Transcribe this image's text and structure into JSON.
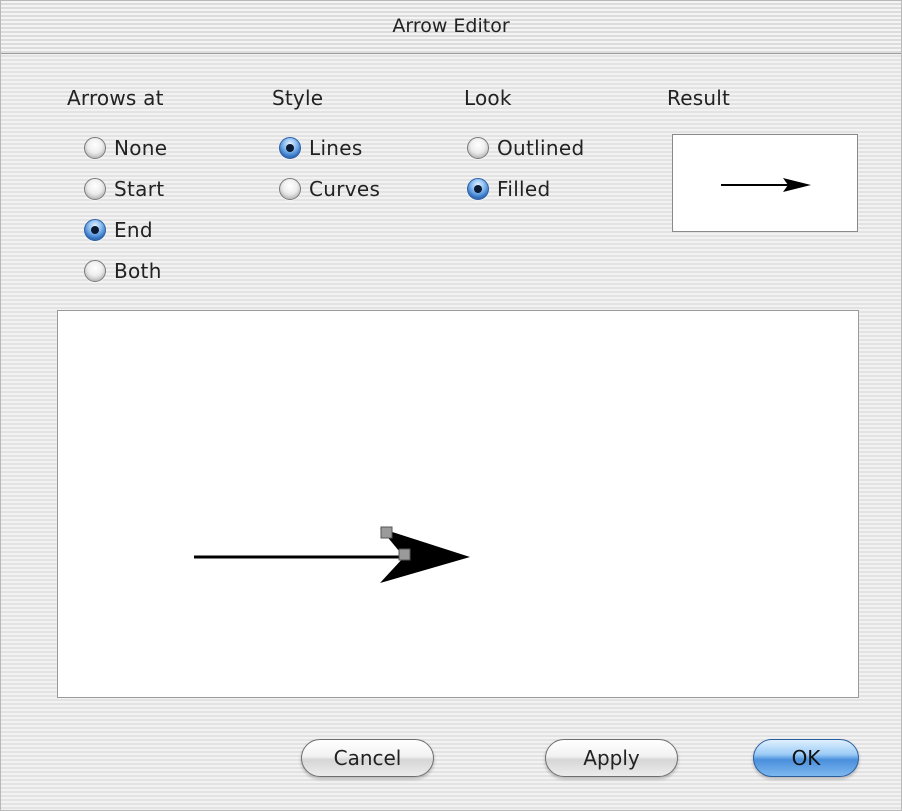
{
  "window": {
    "title": "Arrow Editor"
  },
  "columns": {
    "arrows_at": {
      "heading": "Arrows at",
      "options": [
        "None",
        "Start",
        "End",
        "Both"
      ],
      "selected": "End"
    },
    "style": {
      "heading": "Style",
      "options": [
        "Lines",
        "Curves"
      ],
      "selected": "Lines"
    },
    "look": {
      "heading": "Look",
      "options": [
        "Outlined",
        "Filled"
      ],
      "selected": "Filled"
    },
    "result": {
      "heading": "Result"
    }
  },
  "buttons": {
    "cancel": "Cancel",
    "apply": "Apply",
    "ok": "OK"
  },
  "colors": {
    "arrow": "#000000",
    "handle": "#8c8c8c",
    "default_button": "#4a8fdc"
  }
}
